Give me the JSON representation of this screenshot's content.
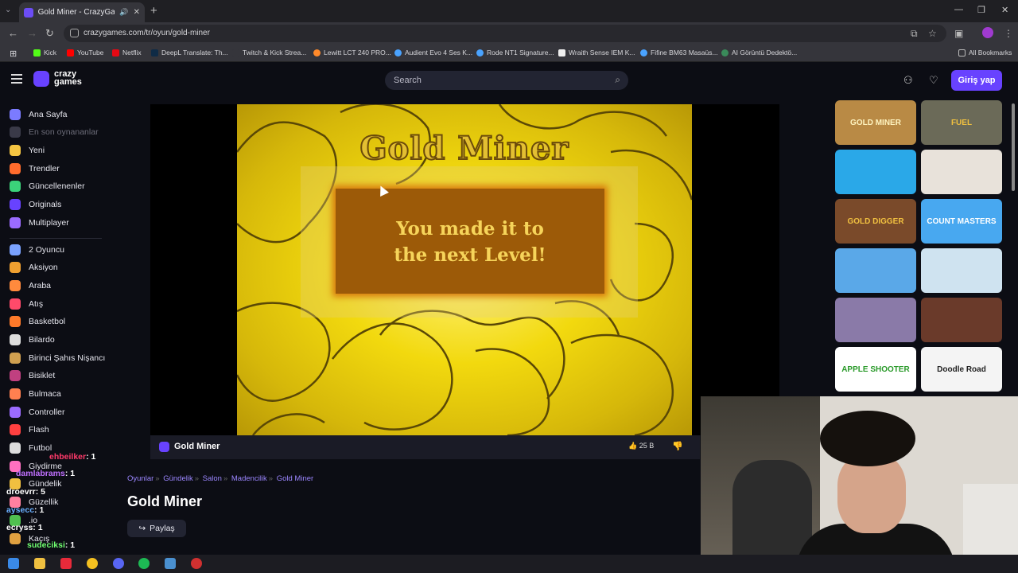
{
  "browser": {
    "tab_title": "Gold Miner - CrazyGames",
    "url": "crazygames.com/tr/oyun/gold-miner",
    "bookmarks": [
      "Kick",
      "YouTube",
      "Netflix",
      "DeepL Translate: Th...",
      "Twitch & Kick Strea...",
      "Lewitt LCT 240 PRO...",
      "Audient Evo 4 Ses K...",
      "Rode NT1 Signature...",
      "Wraith Sense IEM K...",
      "Fifine BM63 Masaüs...",
      "AI Görüntü Dedektö..."
    ],
    "all_bookmarks": "All Bookmarks"
  },
  "header": {
    "logo_line1": "crazy",
    "logo_line2": "games",
    "search_placeholder": "Search",
    "login_label": "Giriş yap"
  },
  "sidebar": {
    "items": [
      {
        "label": "Ana Sayfa",
        "color": "#7b7bff"
      },
      {
        "label": "En son oynananlar",
        "color": "#3a3a48"
      },
      {
        "label": "Yeni",
        "color": "#f5c542"
      },
      {
        "label": "Trendler",
        "color": "#ff6b2c"
      },
      {
        "label": "Güncellenenler",
        "color": "#3bd37a"
      },
      {
        "label": "Originals",
        "color": "#6842ff"
      },
      {
        "label": "Multiplayer",
        "color": "#9b6bff"
      },
      {
        "label": "2 Oyuncu",
        "color": "#7aa2ff"
      },
      {
        "label": "Aksiyon",
        "color": "#f0a030"
      },
      {
        "label": "Araba",
        "color": "#ff8a3d"
      },
      {
        "label": "Atış",
        "color": "#ff4a6a"
      },
      {
        "label": "Basketbol",
        "color": "#ff7a2a"
      },
      {
        "label": "Bilardo",
        "color": "#dddddd"
      },
      {
        "label": "Birinci Şahıs Nişancı",
        "color": "#d0a050"
      },
      {
        "label": "Bisiklet",
        "color": "#c04080"
      },
      {
        "label": "Bulmaca",
        "color": "#ff8050"
      },
      {
        "label": "Controller",
        "color": "#9b6bff"
      },
      {
        "label": "Flash",
        "color": "#ff4040"
      },
      {
        "label": "Futbol",
        "color": "#dddddd"
      },
      {
        "label": "Giydirme",
        "color": "#ff70c0"
      },
      {
        "label": "Gündelik",
        "color": "#f0c040"
      },
      {
        "label": "Güzellik",
        "color": "#ff80a0"
      },
      {
        "label": ".io",
        "color": "#50c050"
      },
      {
        "label": "Kaçış",
        "color": "#e0a040"
      }
    ]
  },
  "game": {
    "title_art": "Gold Miner",
    "message_line1": "You made it to",
    "message_line2": "the next Level!",
    "bar_name": "Gold Miner",
    "likes": "25 B"
  },
  "page": {
    "breadcrumb": [
      "Oyunlar",
      "Gündelik",
      "Salon",
      "Madencilik",
      "Gold Miner"
    ],
    "title": "Gold Miner",
    "share_label": "Paylaş"
  },
  "thumbnails": [
    {
      "label": "GOLD MINER",
      "bg": "#b98a45",
      "fg": "#fff4c0"
    },
    {
      "label": "FUEL",
      "bg": "#6b6a58",
      "fg": "#f0c040"
    },
    {
      "label": "",
      "bg": "#2aa8e8",
      "fg": "#fff"
    },
    {
      "label": "",
      "bg": "#e8e2da",
      "fg": "#000"
    },
    {
      "label": "GOLD DIGGER",
      "bg": "#7a4a2a",
      "fg": "#f0c040"
    },
    {
      "label": "COUNT MASTERS",
      "bg": "#48a8f0",
      "fg": "#fff"
    },
    {
      "label": "",
      "bg": "#5aa8e8",
      "fg": "#fff"
    },
    {
      "label": "",
      "bg": "#cfe3f0",
      "fg": "#000"
    },
    {
      "label": "",
      "bg": "#8a7aa8",
      "fg": "#fff"
    },
    {
      "label": "",
      "bg": "#6a3a2a",
      "fg": "#fff"
    },
    {
      "label": "APPLE SHOOTER",
      "bg": "#ffffff",
      "fg": "#2a9a2a"
    },
    {
      "label": "Doodle Road",
      "bg": "#f4f4f4",
      "fg": "#222"
    }
  ],
  "chat": [
    {
      "user": "ehbeilker",
      "count": ": 1",
      "color": "#ff3a6a"
    },
    {
      "user": "damlabrams",
      "count": ": 1",
      "color": "#c070ff"
    },
    {
      "user": "droevrr",
      "count": ": 5",
      "color": "#ffffff"
    },
    {
      "user": "aysecc",
      "count": ": 1",
      "color": "#6ab0ff"
    },
    {
      "user": "ecryss",
      "count": ": 1",
      "color": "#ffffff"
    },
    {
      "user": "sudeciksi",
      "count": ": 1",
      "color": "#70ff70"
    }
  ]
}
